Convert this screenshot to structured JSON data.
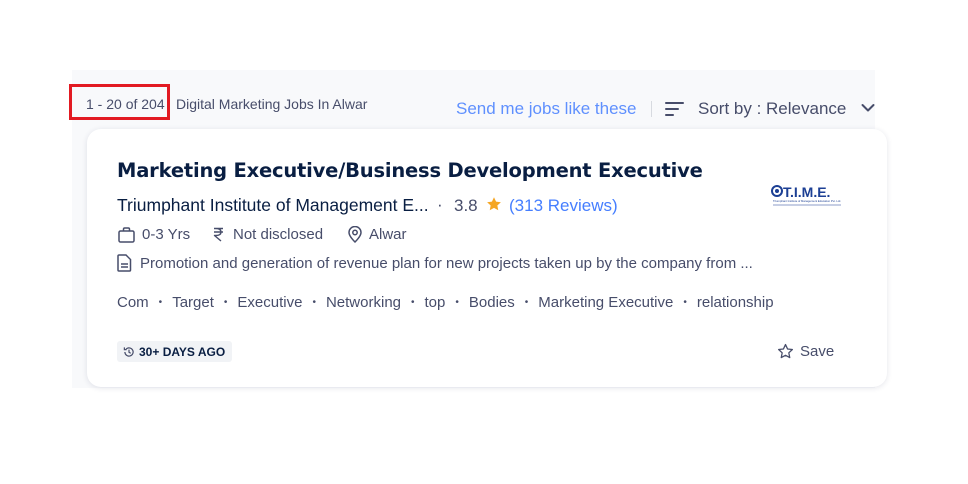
{
  "results": {
    "count": "1 - 20 of 204",
    "label": "Digital Marketing Jobs In Alwar"
  },
  "actions": {
    "send_jobs": "Send me jobs like these",
    "sort": "Sort by : Relevance"
  },
  "job": {
    "title": "Marketing Executive/Business Development Executive",
    "company": "Triumphant Institute of Management E...",
    "separator": "·",
    "rating": "3.8",
    "reviews": "(313 Reviews)",
    "experience": "0-3 Yrs",
    "salary": "Not disclosed",
    "location": "Alwar",
    "description": "Promotion and generation of revenue plan for new projects taken up by the company from ...",
    "tags": [
      "Com",
      "Target",
      "Executive",
      "Networking",
      "top",
      "Bodies",
      "Marketing Executive",
      "relationship"
    ],
    "posted": "30+ DAYS AGO",
    "save_label": "Save",
    "logo": {
      "text": "T.I.M.E.",
      "subtitle": "Triumphant Institute of Management Education Pvt. Ltd."
    }
  },
  "icons": {
    "sort": "sort-lines-icon",
    "chevron": "chevron-down-icon",
    "star": "star-icon",
    "briefcase": "briefcase-icon",
    "rupee": "rupee-icon",
    "location": "location-pin-icon",
    "document": "document-icon",
    "history": "history-icon",
    "save": "star-outline-icon"
  },
  "colors": {
    "highlight": "#e21a22",
    "link": "#457eff",
    "star": "#f5a623",
    "text_dark": "#091e42",
    "text_muted": "#474d6a",
    "logo_blue": "#1c3f94"
  }
}
